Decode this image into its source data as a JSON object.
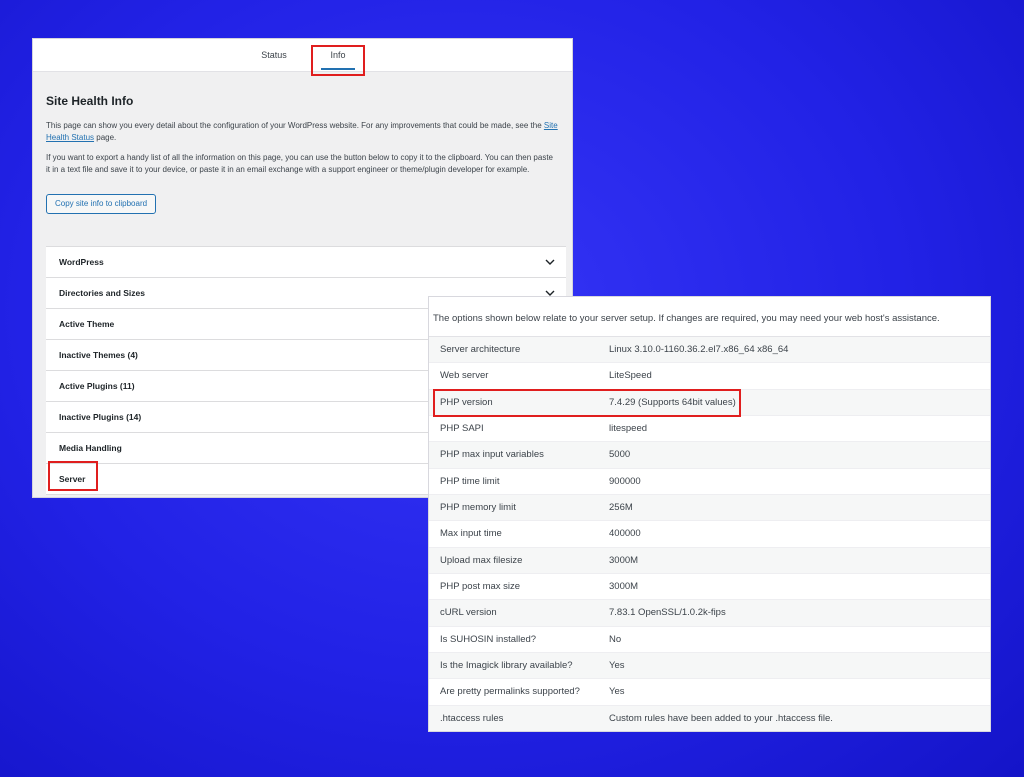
{
  "site_health": {
    "tabs": [
      {
        "label": "Status"
      },
      {
        "label": "Info"
      }
    ],
    "title": "Site Health Info",
    "intro_1_before": "This page can show you every detail about the configuration of your WordPress website. For any improvements that could be made, see the ",
    "intro_1_link": "Site Health Status",
    "intro_1_after": " page.",
    "intro_2": "If you want to export a handy list of all the information on this page, you can use the button below to copy it to the clipboard. You can then paste it in a text file and save it to your device, or paste it in an email exchange with a support engineer or theme/plugin developer for example.",
    "copy_button": "Copy site info to clipboard",
    "sections": [
      {
        "label": "WordPress"
      },
      {
        "label": "Directories and Sizes"
      },
      {
        "label": "Active Theme"
      },
      {
        "label": "Inactive Themes (4)"
      },
      {
        "label": "Active Plugins (11)"
      },
      {
        "label": "Inactive Plugins (14)"
      },
      {
        "label": "Media Handling"
      },
      {
        "label": "Server"
      }
    ]
  },
  "server": {
    "description": "The options shown below relate to your server setup. If changes are required, you may need your web host's assistance.",
    "rows": [
      {
        "label": "Server architecture",
        "value": "Linux 3.10.0-1160.36.2.el7.x86_64 x86_64"
      },
      {
        "label": "Web server",
        "value": "LiteSpeed"
      },
      {
        "label": "PHP version",
        "value": "7.4.29 (Supports 64bit values)"
      },
      {
        "label": "PHP SAPI",
        "value": "litespeed"
      },
      {
        "label": "PHP max input variables",
        "value": "5000"
      },
      {
        "label": "PHP time limit",
        "value": "900000"
      },
      {
        "label": "PHP memory limit",
        "value": "256M"
      },
      {
        "label": "Max input time",
        "value": "400000"
      },
      {
        "label": "Upload max filesize",
        "value": "3000M"
      },
      {
        "label": "PHP post max size",
        "value": "3000M"
      },
      {
        "label": "cURL version",
        "value": "7.83.1 OpenSSL/1.0.2k-fips"
      },
      {
        "label": "Is SUHOSIN installed?",
        "value": "No"
      },
      {
        "label": "Is the Imagick library available?",
        "value": "Yes"
      },
      {
        "label": "Are pretty permalinks supported?",
        "value": "Yes"
      },
      {
        "label": ".htaccess rules",
        "value": "Custom rules have been added to your .htaccess file."
      }
    ]
  },
  "colors": {
    "background": "#2626ea",
    "highlight": "#e01e1e",
    "link": "#2271b1"
  },
  "icons": {
    "accordion_toggle": "chevron-down-icon"
  }
}
